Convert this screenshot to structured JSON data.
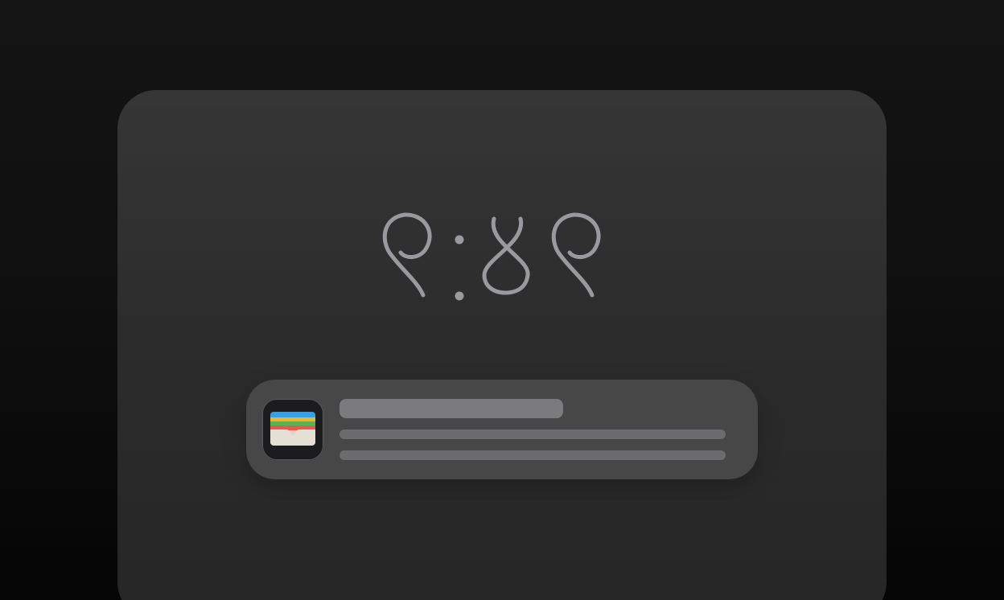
{
  "lock_screen": {
    "clock": {
      "time": "၉:၄၉",
      "color": "#9a9a9e"
    },
    "notification": {
      "app_icon": "wallet-icon",
      "title": "",
      "body_lines": [
        "",
        ""
      ],
      "background": "#474747",
      "placeholder_color": "#7b7b7e"
    }
  }
}
